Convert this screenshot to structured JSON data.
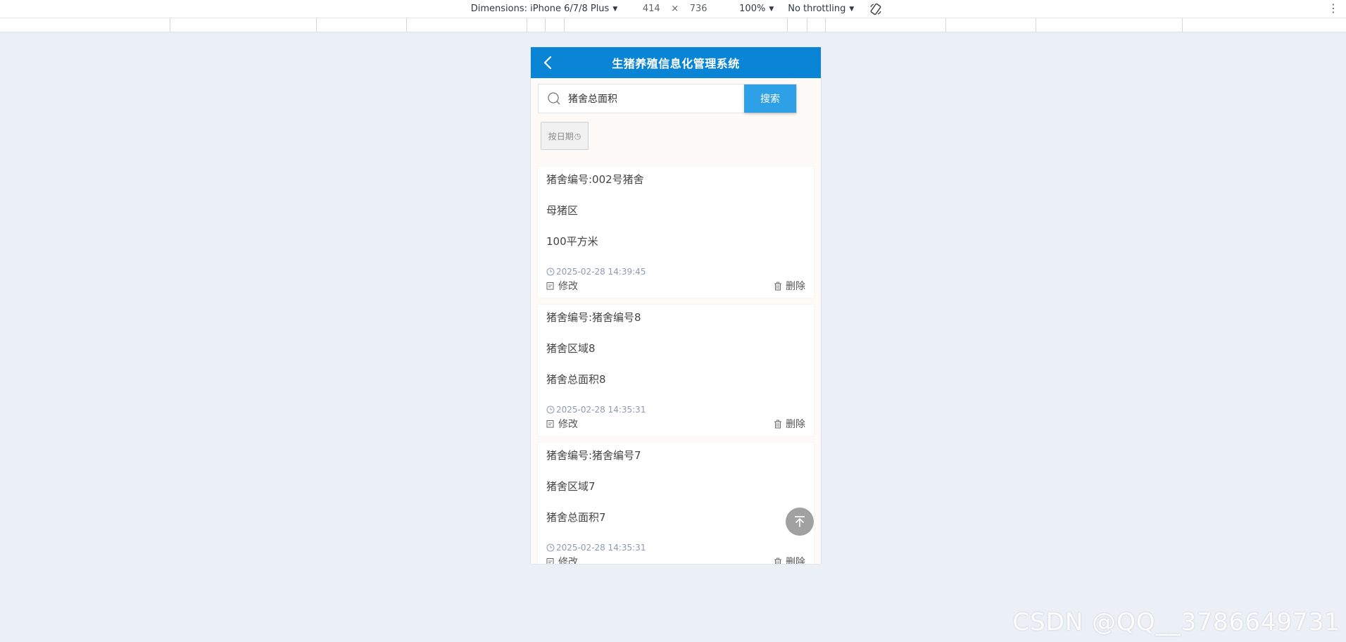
{
  "devtools": {
    "device": "Dimensions: iPhone 6/7/8 Plus",
    "width": "414",
    "times": "×",
    "height": "736",
    "zoom": "100%",
    "throttle": "No throttling",
    "rotate_icon": "rotate-icon",
    "menu_icon": "kebab-menu-icon"
  },
  "app": {
    "title": "生猪养殖信息化管理系统",
    "header_color": "#0a84d5"
  },
  "search": {
    "value": "猪舍总面积",
    "button": "搜索"
  },
  "filter": {
    "date_label": "按日期",
    "date_icon": "◷"
  },
  "records": [
    {
      "code": "猪舍编号:002号猪舍",
      "area": "母猪区",
      "size": "100平方米",
      "time": "2025-02-28 14:39:45",
      "edit": "修改",
      "delete": "删除"
    },
    {
      "code": "猪舍编号:猪舍编号8",
      "area": "猪舍区域8",
      "size": "猪舍总面积8",
      "time": "2025-02-28 14:35:31",
      "edit": "修改",
      "delete": "删除"
    },
    {
      "code": "猪舍编号:猪舍编号7",
      "area": "猪舍区域7",
      "size": "猪舍总面积7",
      "time": "2025-02-28 14:35:31",
      "edit": "修改",
      "delete": "删除"
    }
  ],
  "watermark": "CSDN @QQ__3786649731"
}
